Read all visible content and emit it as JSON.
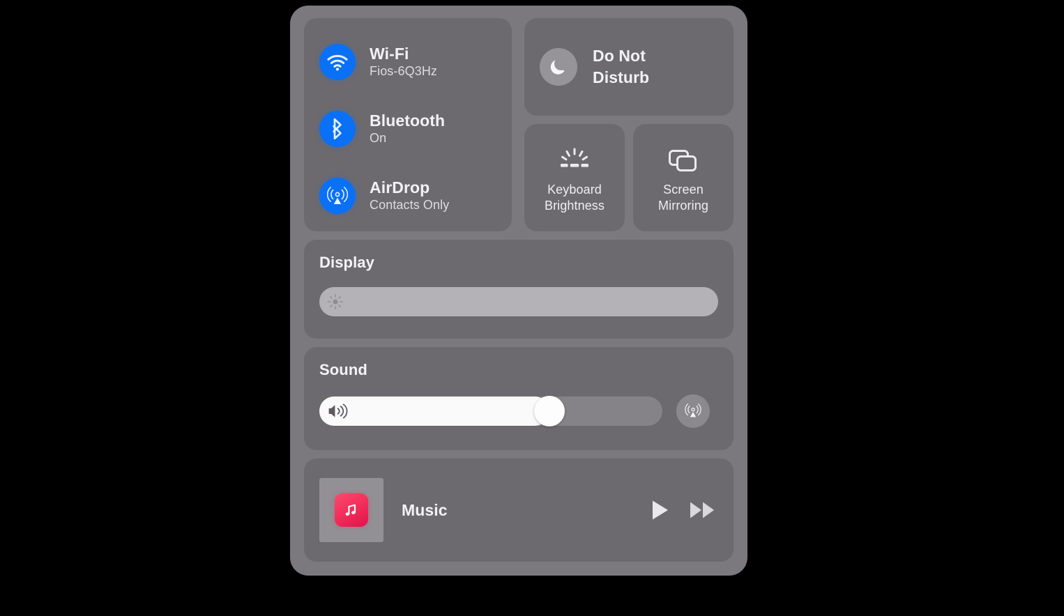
{
  "panel": {
    "name": "Control Center",
    "accent_blue": "#0a70f5",
    "panel_bg": "#7b797d",
    "card_bg": "#6c6a6f"
  },
  "connectivity": {
    "rows": [
      {
        "icon": "wifi-icon",
        "title": "Wi-Fi",
        "subtitle": "Fios-6Q3Hz"
      },
      {
        "icon": "bluetooth-icon",
        "title": "Bluetooth",
        "subtitle": "On"
      },
      {
        "icon": "airdrop-icon",
        "title": "AirDrop",
        "subtitle": "Contacts Only"
      }
    ]
  },
  "do_not_disturb": {
    "icon": "moon-icon",
    "label_line1": "Do Not",
    "label_line2": "Disturb"
  },
  "tiles": [
    {
      "icon": "keyboard-brightness-icon",
      "label_line1": "Keyboard",
      "label_line2": "Brightness"
    },
    {
      "icon": "screen-mirroring-icon",
      "label_line1": "Screen",
      "label_line2": "Mirroring"
    }
  ],
  "display": {
    "title": "Display",
    "slider_glyph": "brightness-sun-icon",
    "slider_value": 100,
    "fill_color": "#b4b2b6"
  },
  "sound": {
    "title": "Sound",
    "slider_glyph": "speaker-wave-icon",
    "slider_value": 67,
    "fill_color": "#fbfafb",
    "airplay_icon": "airplay-audio-icon"
  },
  "music": {
    "album_art": "album-art-placeholder",
    "app_icon": "music-app-icon",
    "app_icon_color": "#f3315c",
    "title": "Music",
    "controls": [
      {
        "icon": "play-icon",
        "name": "play-button"
      },
      {
        "icon": "fast-forward-icon",
        "name": "next-button"
      }
    ]
  }
}
